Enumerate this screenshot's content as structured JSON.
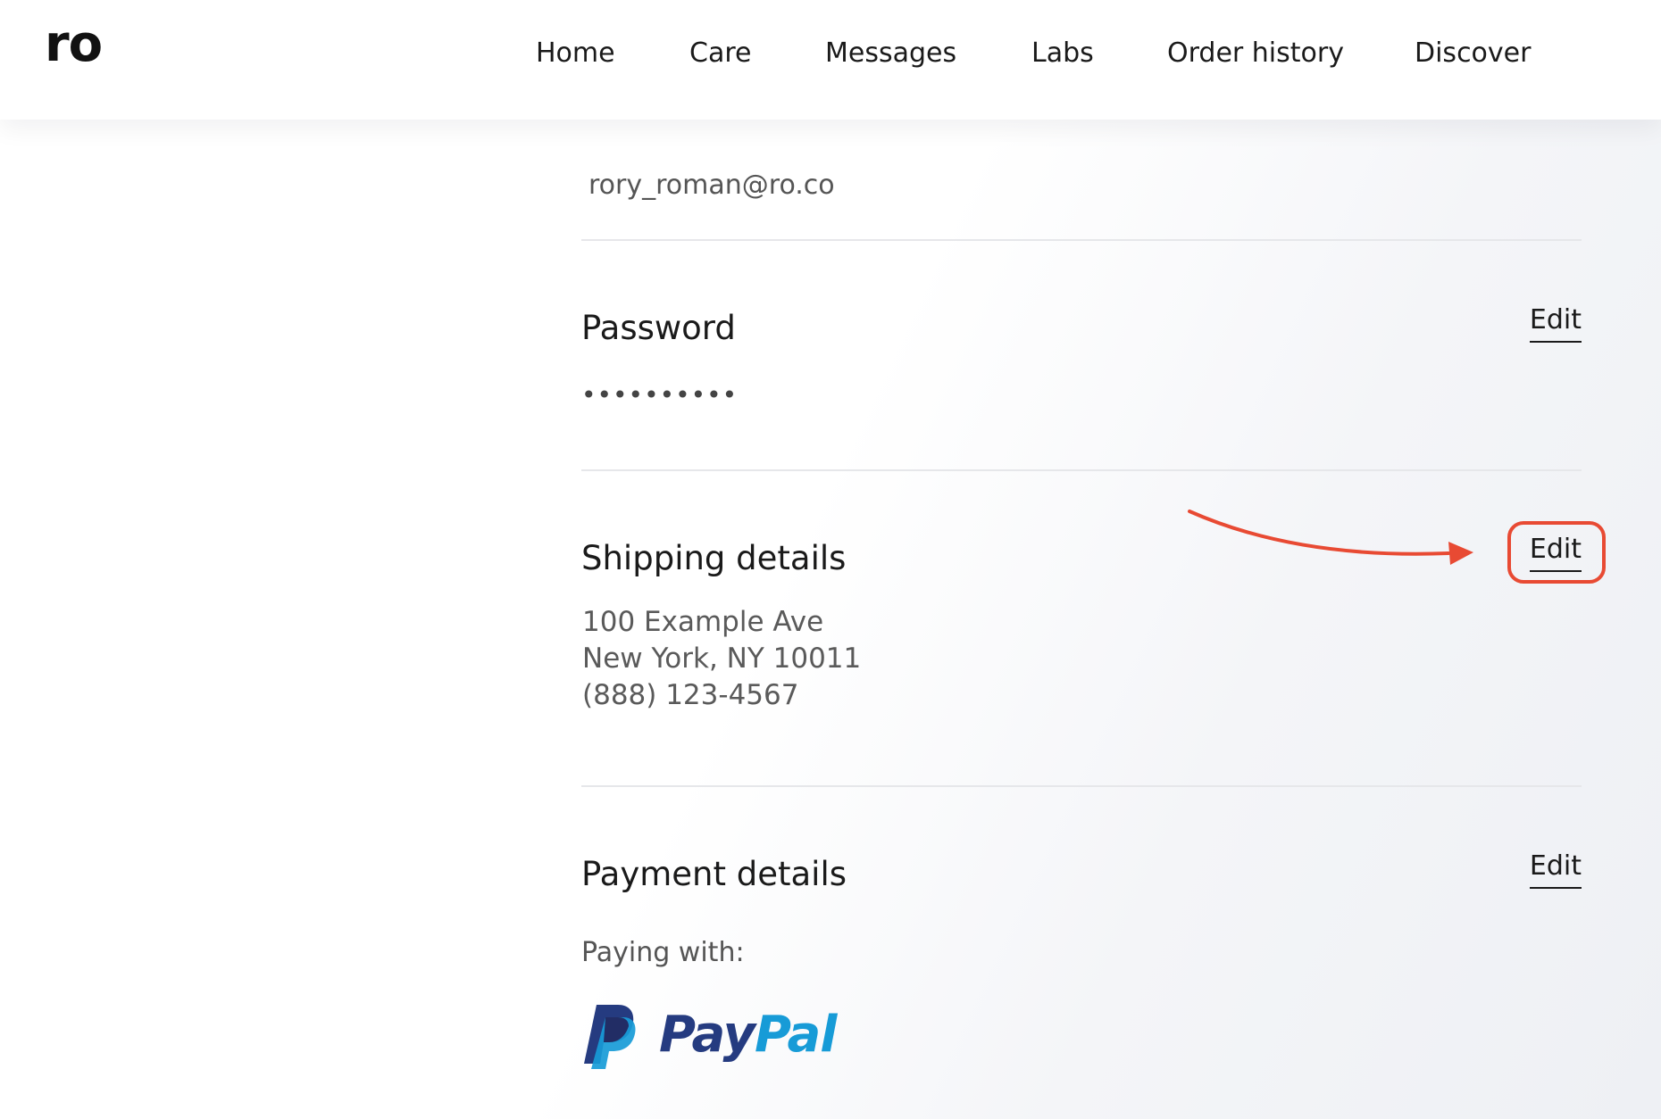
{
  "header": {
    "logo": "ro",
    "nav": [
      {
        "label": "Home"
      },
      {
        "label": "Care"
      },
      {
        "label": "Messages"
      },
      {
        "label": "Labs"
      },
      {
        "label": "Order history"
      },
      {
        "label": "Discover"
      }
    ]
  },
  "account": {
    "email": "rory_roman@ro.co",
    "password": {
      "title": "Password",
      "value": "••••••••••",
      "edit_label": "Edit"
    },
    "shipping": {
      "title": "Shipping details",
      "address_line1": "100 Example Ave",
      "address_line2": "New York, NY 10011",
      "phone": "(888) 123-4567",
      "edit_label": "Edit"
    },
    "payment": {
      "title": "Payment details",
      "paying_with_label": "Paying with:",
      "method_logo": "PayPal",
      "edit_label": "Edit"
    }
  },
  "annotation": {
    "color": "#e84a33",
    "target": "shipping edit button"
  },
  "colors": {
    "paypal_dark": "#253b80",
    "paypal_light": "#179bd7"
  }
}
